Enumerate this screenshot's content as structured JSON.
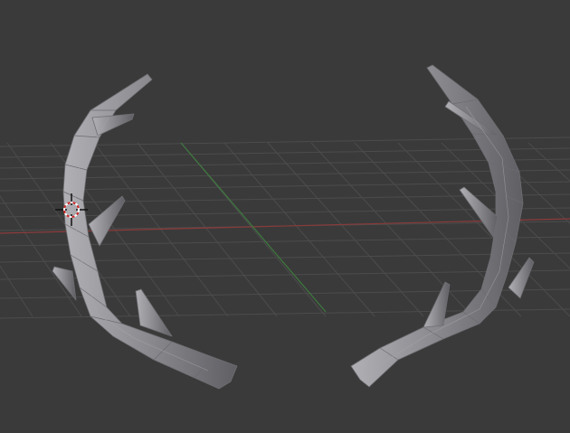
{
  "viewport": {
    "background": "#3a3a3a",
    "grid_color": "#4c4c4c",
    "x_axis_color": "#8c3a3a",
    "y_axis_color": "#3f7a3f"
  },
  "objects": [
    {
      "name": "antler-left",
      "material_color": "#8f8f94"
    },
    {
      "name": "antler-right",
      "material_color": "#8f8f94"
    }
  ],
  "cursor": {
    "icon": "3d-cursor-icon"
  }
}
